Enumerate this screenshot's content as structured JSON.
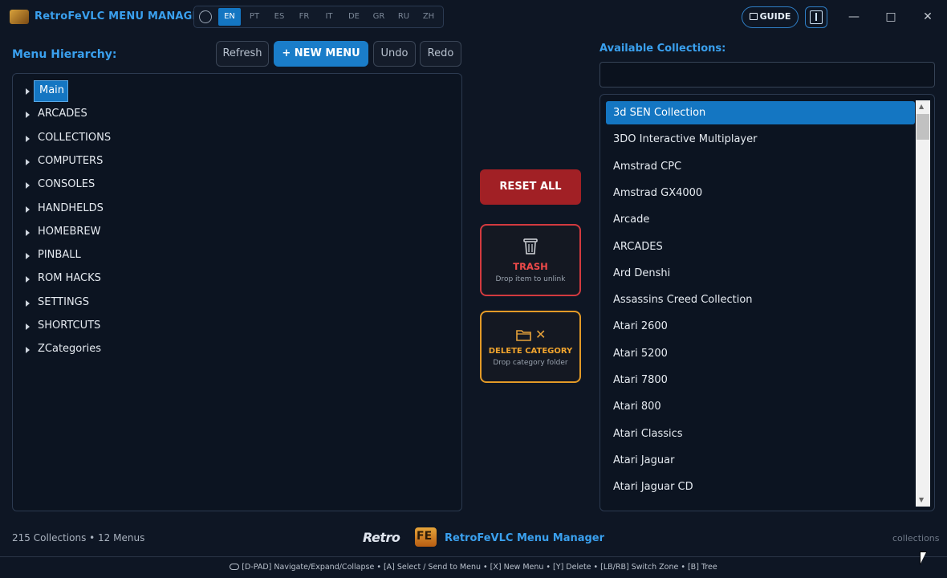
{
  "app": {
    "title": "RetroFeVLC MENU MANAGER"
  },
  "languages": {
    "items": [
      "EN",
      "PT",
      "ES",
      "FR",
      "IT",
      "DE",
      "GR",
      "RU",
      "ZH"
    ],
    "active": "EN"
  },
  "header_buttons": {
    "guide": "GUIDE"
  },
  "hierarchy": {
    "title": "Menu Hierarchy:",
    "refresh_label": "Refresh",
    "new_menu_label": "+ NEW MENU",
    "undo_label": "Undo",
    "redo_label": "Redo",
    "items": [
      "Main",
      "ARCADES",
      "COLLECTIONS",
      "COMPUTERS",
      "CONSOLES",
      "HANDHELDS",
      "HOMEBREW",
      "PINBALL",
      "ROM HACKS",
      "SETTINGS",
      "SHORTCUTS",
      "ZCategories"
    ],
    "selected": "Main"
  },
  "actions": {
    "reset_label": "RESET ALL",
    "trash_title": "TRASH",
    "trash_sub": "Drop item to unlink",
    "delete_title": "DELETE CATEGORY",
    "delete_sub": "Drop category folder"
  },
  "collections": {
    "title": "Available Collections:",
    "search_value": "",
    "items": [
      "3d SEN Collection",
      "3DO Interactive Multiplayer",
      "Amstrad CPC",
      "Amstrad GX4000",
      "Arcade",
      "ARCADES",
      "Ard Denshi",
      "Assassins Creed Collection",
      "Atari 2600",
      "Atari 5200",
      "Atari 7800",
      "Atari 800",
      "Atari Classics",
      "Atari Jaguar",
      "Atari Jaguar CD"
    ],
    "selected": "3d SEN Collection"
  },
  "footer": {
    "stats": "215 Collections • 12 Menus",
    "logo_text": "Retro",
    "logo_badge": "FE",
    "title": "RetroFeVLC Menu Manager",
    "right_text": "collections",
    "hints": "[D-PAD] Navigate/Expand/Collapse  •  [A] Select / Send to Menu  •  [X] New Menu  •  [Y] Delete  •  [LB/RB] Switch Zone  •  [B] Tree"
  },
  "colors": {
    "accent": "#3aa0ee",
    "primary": "#1a7dc9",
    "selection": "#1476c2",
    "danger": "#a12025",
    "trash_border": "#d23a3f",
    "warning": "#e39a27",
    "background": "#0e1624"
  },
  "icons": {
    "app_logo": "retrofe-logo-icon",
    "globe": "globe-icon",
    "guide": "book-icon",
    "info": "info-icon",
    "trash": "trash-can-icon",
    "folder": "folder-icon",
    "close": "x-icon",
    "gamepad": "gamepad-icon"
  }
}
